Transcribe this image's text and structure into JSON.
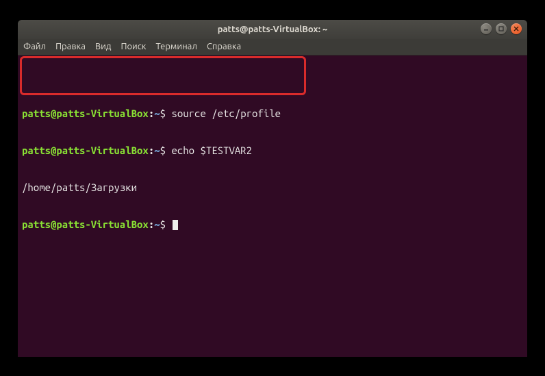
{
  "titlebar": {
    "title": "patts@patts-VirtualBox: ~"
  },
  "window_controls": {
    "minimize": "minimize",
    "maximize": "maximize",
    "close": "close"
  },
  "menubar": {
    "items": [
      "Файл",
      "Правка",
      "Вид",
      "Поиск",
      "Терминал",
      "Справка"
    ]
  },
  "terminal": {
    "lines": [
      {
        "prompt": {
          "user": "patts@patts-VirtualBox",
          "colon": ":",
          "path": "~",
          "dollar": "$"
        },
        "command": "source /etc/profile"
      },
      {
        "prompt": {
          "user": "patts@patts-VirtualBox",
          "colon": ":",
          "path": "~",
          "dollar": "$"
        },
        "command": "echo $TESTVAR2"
      },
      {
        "output": "/home/patts/Загрузки"
      },
      {
        "prompt": {
          "user": "patts@patts-VirtualBox",
          "colon": ":",
          "path": "~",
          "dollar": "$"
        },
        "command": "",
        "cursor": true
      }
    ]
  }
}
